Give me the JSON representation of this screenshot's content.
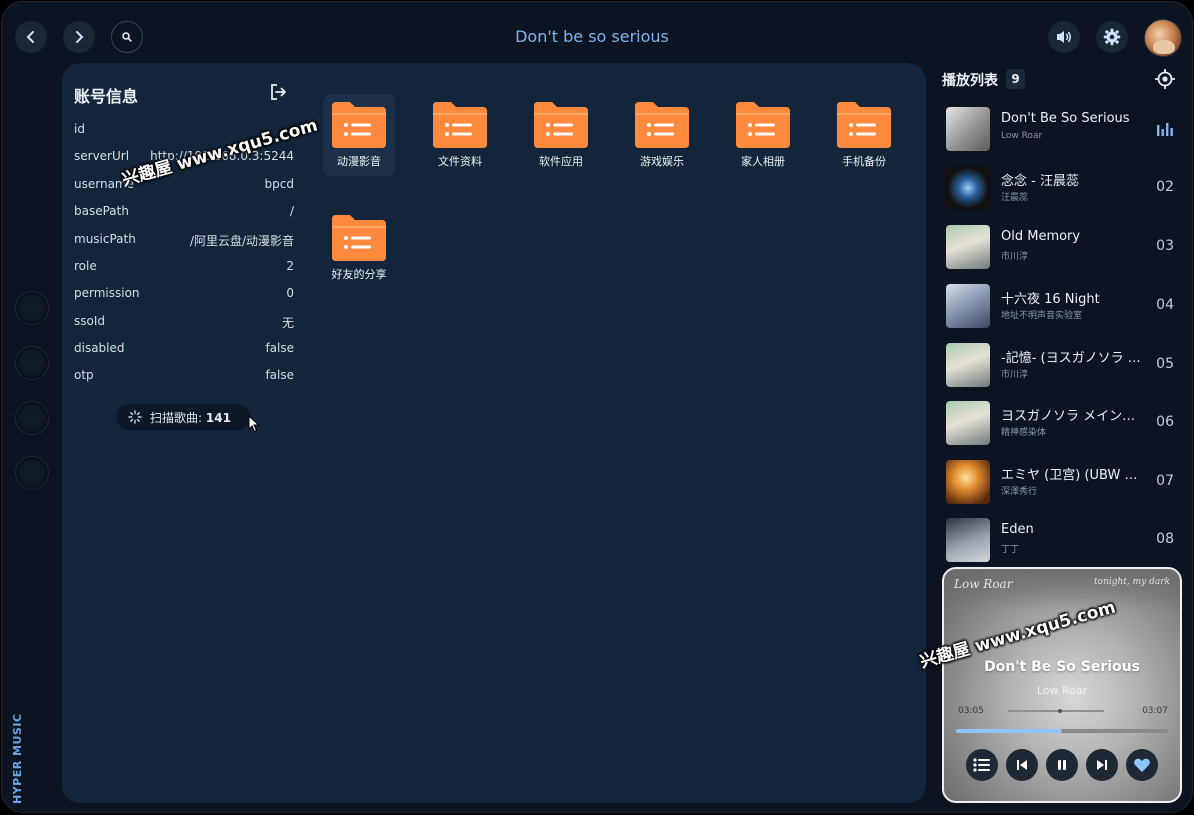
{
  "header": {
    "title": "Don't be so serious",
    "brand": "HYPER MUSIC"
  },
  "account": {
    "title": "账号信息",
    "rows": [
      {
        "key": "id",
        "value": ""
      },
      {
        "key": "serverUrl",
        "value": "http://192.168.0.3:5244"
      },
      {
        "key": "username",
        "value": "bpcd"
      },
      {
        "key": "basePath",
        "value": "/"
      },
      {
        "key": "musicPath",
        "value": "/阿里云盘/动漫影音"
      },
      {
        "key": "role",
        "value": "2"
      },
      {
        "key": "permission",
        "value": "0"
      },
      {
        "key": "ssoId",
        "value": "无"
      },
      {
        "key": "disabled",
        "value": "false"
      },
      {
        "key": "otp",
        "value": "false"
      }
    ],
    "scan_label": "扫描歌曲:",
    "scan_count": "141"
  },
  "folders": [
    "动漫影音",
    "文件资料",
    "软件应用",
    "游戏娱乐",
    "家人相册",
    "手机备份",
    "好友的分享"
  ],
  "playlist": {
    "title": "播放列表",
    "count": "9",
    "songs": [
      {
        "name": "Don't Be So Serious",
        "artist": "Low Roar",
        "num": ""
      },
      {
        "name": "念念 - 汪晨蕊",
        "artist": "汪晨蕊",
        "num": "02"
      },
      {
        "name": "Old Memory",
        "artist": "市川淳",
        "num": "03"
      },
      {
        "name": "十六夜   16 Night",
        "artist": "地址不明声音实验室",
        "num": "04"
      },
      {
        "name": "-記憶- (ヨスガノソラ メインテーマ)",
        "artist": "市川淳",
        "num": "05"
      },
      {
        "name": "ヨスガノソラ メインテーマ",
        "artist": "精神感染体",
        "num": "06"
      },
      {
        "name": "エミヤ (卫宫) (UBW Extended)",
        "artist": "深澤秀行",
        "num": "07"
      },
      {
        "name": "Eden",
        "artist": "丁丁",
        "num": "08"
      }
    ]
  },
  "player": {
    "script_left": "Low Roar",
    "script_right": "tonight, my dark",
    "title": "Don't Be So Serious",
    "artist": "Low Roar",
    "current": "03:05",
    "duration": "03:07",
    "progress": 0.5
  },
  "watermark": "兴趣屋 www.xqu5.com",
  "colors": {
    "accent": "#7fb4ef",
    "folder": "#ff8a3d",
    "panel": "#12253a",
    "background": "#0b1420"
  }
}
